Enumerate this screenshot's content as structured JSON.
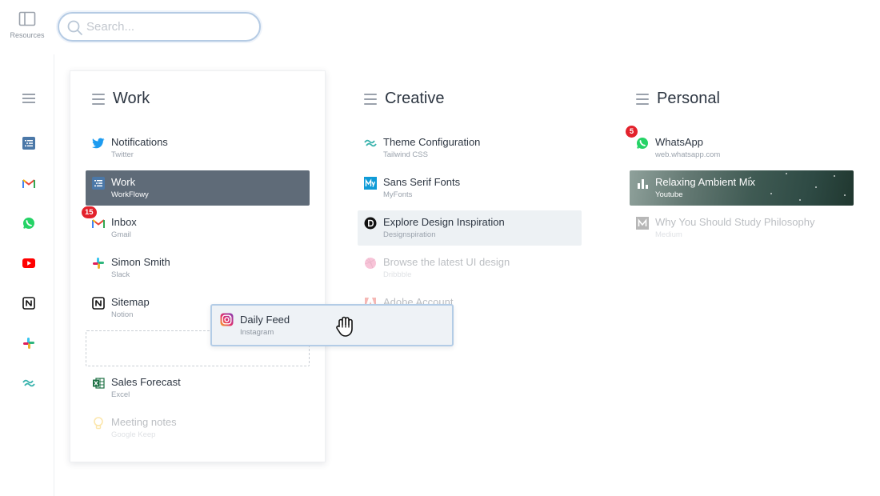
{
  "topbar": {
    "resources_label": "Resources",
    "search_placeholder": "Search..."
  },
  "rail": {
    "icons": [
      "menu-icon",
      "workflowy-icon",
      "gmail-icon",
      "whatsapp-icon",
      "youtube-icon",
      "notion-icon",
      "slack-icon",
      "tailwind-icon"
    ]
  },
  "columns": {
    "work": {
      "title": "Work",
      "items": [
        {
          "title": "Notifications",
          "subtitle": "Twitter",
          "icon": "twitter-icon"
        },
        {
          "title": "Work",
          "subtitle": "WorkFlowy",
          "icon": "workflowy-icon",
          "state": "selected"
        },
        {
          "title": "Inbox",
          "subtitle": "Gmail",
          "icon": "gmail-icon",
          "badge": "15"
        },
        {
          "title": "Simon Smith",
          "subtitle": "Slack",
          "icon": "slack-icon"
        },
        {
          "title": "Sitemap",
          "subtitle": "Notion",
          "icon": "notion-icon"
        },
        {
          "title": "Sales Forecast",
          "subtitle": "Excel",
          "icon": "excel-icon"
        },
        {
          "title": "Meeting notes",
          "subtitle": "Google Keep",
          "icon": "google-keep-icon",
          "state": "faded"
        }
      ]
    },
    "creative": {
      "title": "Creative",
      "items": [
        {
          "title": "Theme Configuration",
          "subtitle": "Tailwind CSS",
          "icon": "tailwind-icon"
        },
        {
          "title": "Sans Serif Fonts",
          "subtitle": "MyFonts",
          "icon": "myfonts-icon"
        },
        {
          "title": "Explore Design Inspiration",
          "subtitle": "Designspiration",
          "icon": "designspiration-icon",
          "state": "hover"
        },
        {
          "title": "Browse the latest UI design",
          "subtitle": "Dribbble",
          "icon": "dribbble-icon",
          "state": "faded"
        },
        {
          "title": "Adobe Account",
          "subtitle": "",
          "icon": "adobe-icon",
          "state": "faded"
        }
      ]
    },
    "personal": {
      "title": "Personal",
      "items": [
        {
          "title": "WhatsApp",
          "subtitle": "web.whatsapp.com",
          "icon": "whatsapp-icon",
          "badge": "5"
        },
        {
          "title": "Relaxing Ambient Mix",
          "subtitle": "Youtube",
          "icon": "bar-chart-icon",
          "state": "image"
        },
        {
          "title": "Why You Should Study Philosophy",
          "subtitle": "Medium",
          "icon": "medium-icon",
          "state": "faded"
        }
      ]
    }
  },
  "dragging": {
    "title": "Daily Feed",
    "subtitle": "Instagram",
    "icon": "instagram-icon"
  },
  "colors": {
    "selected_bg": "#5f6b78",
    "hover_bg": "#edf1f4",
    "badge": "#e3222c",
    "drag_border": "#b3cce6"
  }
}
